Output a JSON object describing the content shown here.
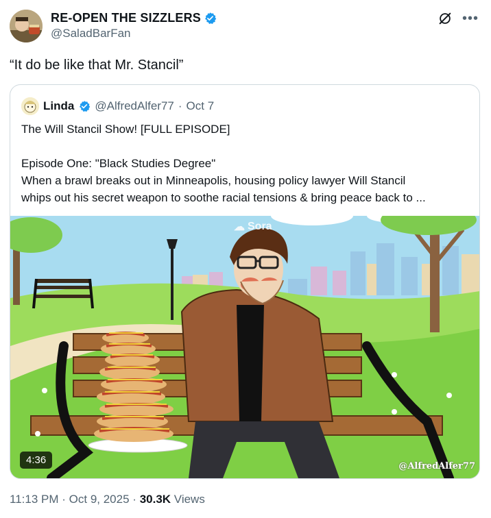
{
  "author": {
    "display_name": "RE-OPEN THE SIZZLERS",
    "handle": "@SaladBarFan",
    "verified_color": "#1d9bf0"
  },
  "tweet": {
    "text": "“It do be like that Mr. Stancil”"
  },
  "quoted": {
    "display_name": "Linda",
    "handle": "@AlfredAlfer77",
    "separator": "·",
    "date": "Oct 7",
    "lines": [
      "The Will Stancil Show! [FULL EPISODE]",
      "",
      "Episode One: \"Black Studies Degree\"",
      "When a brawl breaks out in Minneapolis, housing policy lawyer Will Stancil",
      "whips out his secret weapon to soothe racial tensions & bring peace back to ..."
    ],
    "video": {
      "duration": "4:36",
      "watermark": "@AlfredAlfer77",
      "sora_label": "Sora"
    }
  },
  "meta": {
    "time": "11:13 PM",
    "sep1": "·",
    "date": "Oct 9, 2025",
    "sep2": "·",
    "views_count": "30.3K",
    "views_label": "Views"
  },
  "icons": {
    "grok": "grok-icon",
    "more": "more-icon",
    "verified": "verified-badge-icon"
  }
}
